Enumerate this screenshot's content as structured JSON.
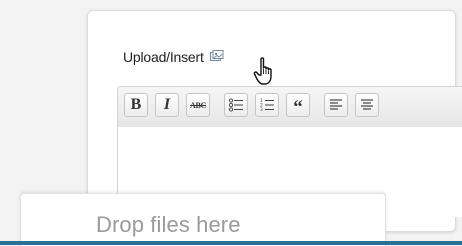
{
  "upload": {
    "label": "Upload/Insert",
    "media_icon": "add-media-icon"
  },
  "cursor": {
    "icon": "hand-pointer-icon"
  },
  "toolbar": {
    "bold_label": "B",
    "italic_label": "I",
    "strike_label": "ABC",
    "quote_label": "“",
    "buttons": [
      "bold-icon",
      "italic-icon",
      "strikethrough-icon",
      "unordered-list-icon",
      "ordered-list-icon",
      "blockquote-icon",
      "align-left-icon",
      "align-center-icon"
    ]
  },
  "drop_zone": {
    "label": "Drop files here"
  },
  "colors": {
    "accent_bar": "#2d6f94",
    "drop_text": "#9a9a9a"
  }
}
